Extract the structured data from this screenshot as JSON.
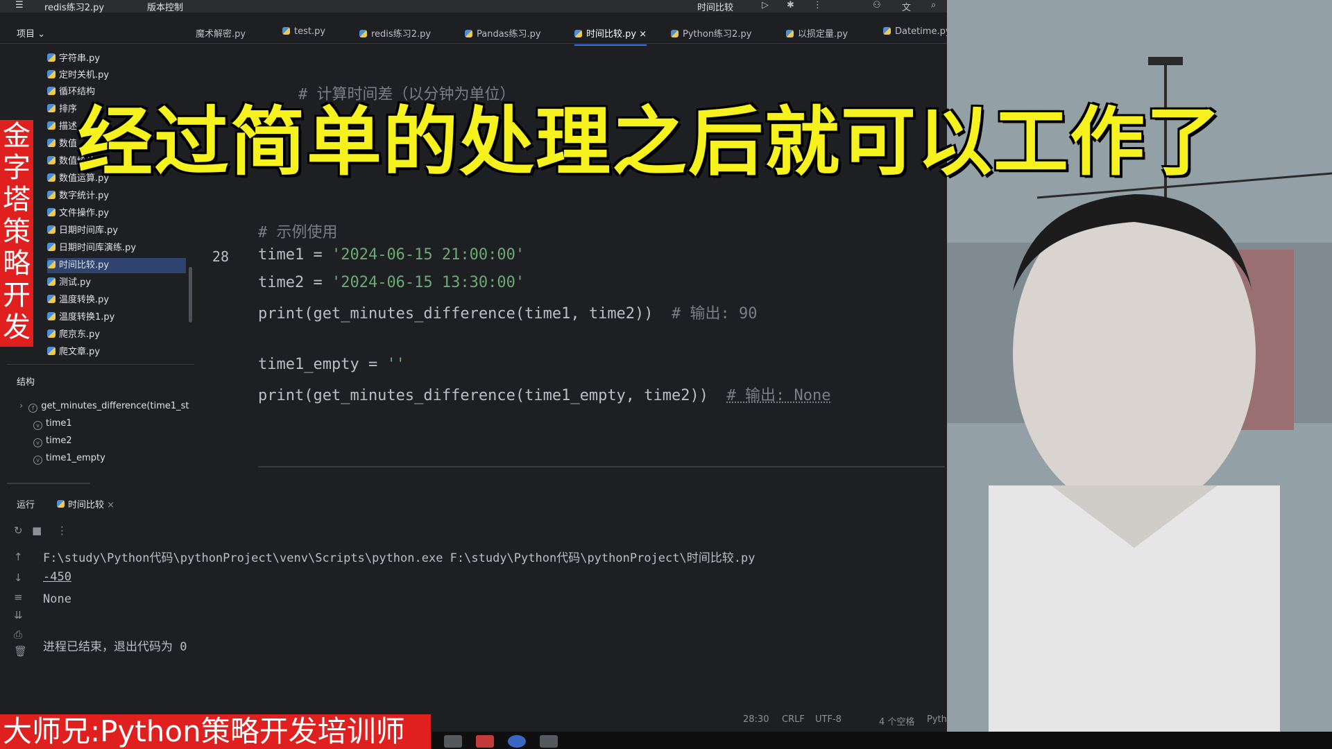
{
  "titlebar": {
    "menu_icon": "hamburger-icon",
    "project": "redis练习2.py",
    "vcs": "版本控制",
    "run_config": "时间比较"
  },
  "editor_tabs": [
    {
      "label": "魔术解密.py"
    },
    {
      "label": "test.py"
    },
    {
      "label": "redis练习2.py"
    },
    {
      "label": "Pandas练习.py"
    },
    {
      "label": "时间比较.py"
    },
    {
      "label": "Python练习2.py"
    },
    {
      "label": "以损定量.py"
    },
    {
      "label": "Datetime.py"
    }
  ],
  "project_panel": {
    "title": "项目",
    "files": [
      "字符串.py",
      "定时关机.py",
      "循环结构",
      "排序",
      "描述",
      "数值",
      "数值统计.py",
      "数值运算.py",
      "数字统计.py",
      "文件操作.py",
      "日期时间库.py",
      "日期时间库演练.py",
      "时间比较.py",
      "测试.py",
      "温度转换.py",
      "温度转换1.py",
      "爬京东.py",
      "爬文章.py"
    ]
  },
  "structure_panel": {
    "title": "结构",
    "items": [
      "get_minutes_difference(time1_st",
      "time1",
      "time2",
      "time1_empty"
    ]
  },
  "code": {
    "line_28": "28",
    "comment_top": "# 计算时间差（以分钟为单位）",
    "comment_example": "# 示例使用",
    "time1_var": "time1 = ",
    "time1_val": "'2024-06-15 21:00:00'",
    "time2_var": "time2 = ",
    "time2_val": "'2024-06-15 13:30:00'",
    "print1": "print(get_minutes_difference(time1, time2))",
    "print1_comment": "# 输出: 90",
    "empty_var": "time1_empty = ",
    "empty_val": "''",
    "print2": "print(get_minutes_difference(time1_empty, time2))",
    "print2_comment": "# 输出: None"
  },
  "run_panel": {
    "label": "运行",
    "tab": "时间比较",
    "command": "F:\\study\\Python代码\\pythonProject\\venv\\Scripts\\python.exe F:\\study\\Python代码\\pythonProject\\时间比较.py",
    "output1": "-450",
    "output2": "None",
    "exit": "进程已结束，退出代码为 0"
  },
  "statusbar": {
    "position": "28:30",
    "line_sep": "CRLF",
    "encoding": "UTF-8",
    "indent": "4 个空格",
    "lang": "Pyth"
  },
  "overlays": {
    "title": "经过简单的处理之后就可以工作了",
    "side": "金字塔策略开发",
    "bottom": "大师兄:Python策略开发培训师"
  },
  "colors": {
    "banner_red": "#e0201e",
    "title_yellow": "#f5f21d",
    "accent_blue": "#3574f0"
  }
}
